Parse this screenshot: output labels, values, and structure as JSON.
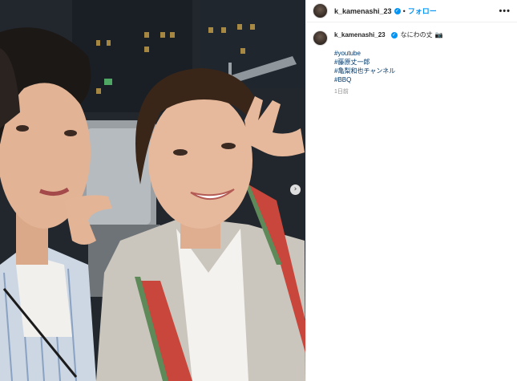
{
  "header": {
    "username": "k_kamenashi_23",
    "verified_icon": "verified-badge-icon",
    "separator": "•",
    "follow_label": "フォロー",
    "more_label": "•••"
  },
  "caption": {
    "username": "k_kamenashi_23",
    "text": "なにわの丈",
    "emoji": "📷",
    "hashtags": [
      "#youtube",
      "#藤原丈一郎",
      "#亀梨和也チャンネル",
      "#BBQ"
    ],
    "time": "1日前"
  },
  "media": {
    "next_icon": "chevron-right-icon",
    "next_label": "›"
  }
}
